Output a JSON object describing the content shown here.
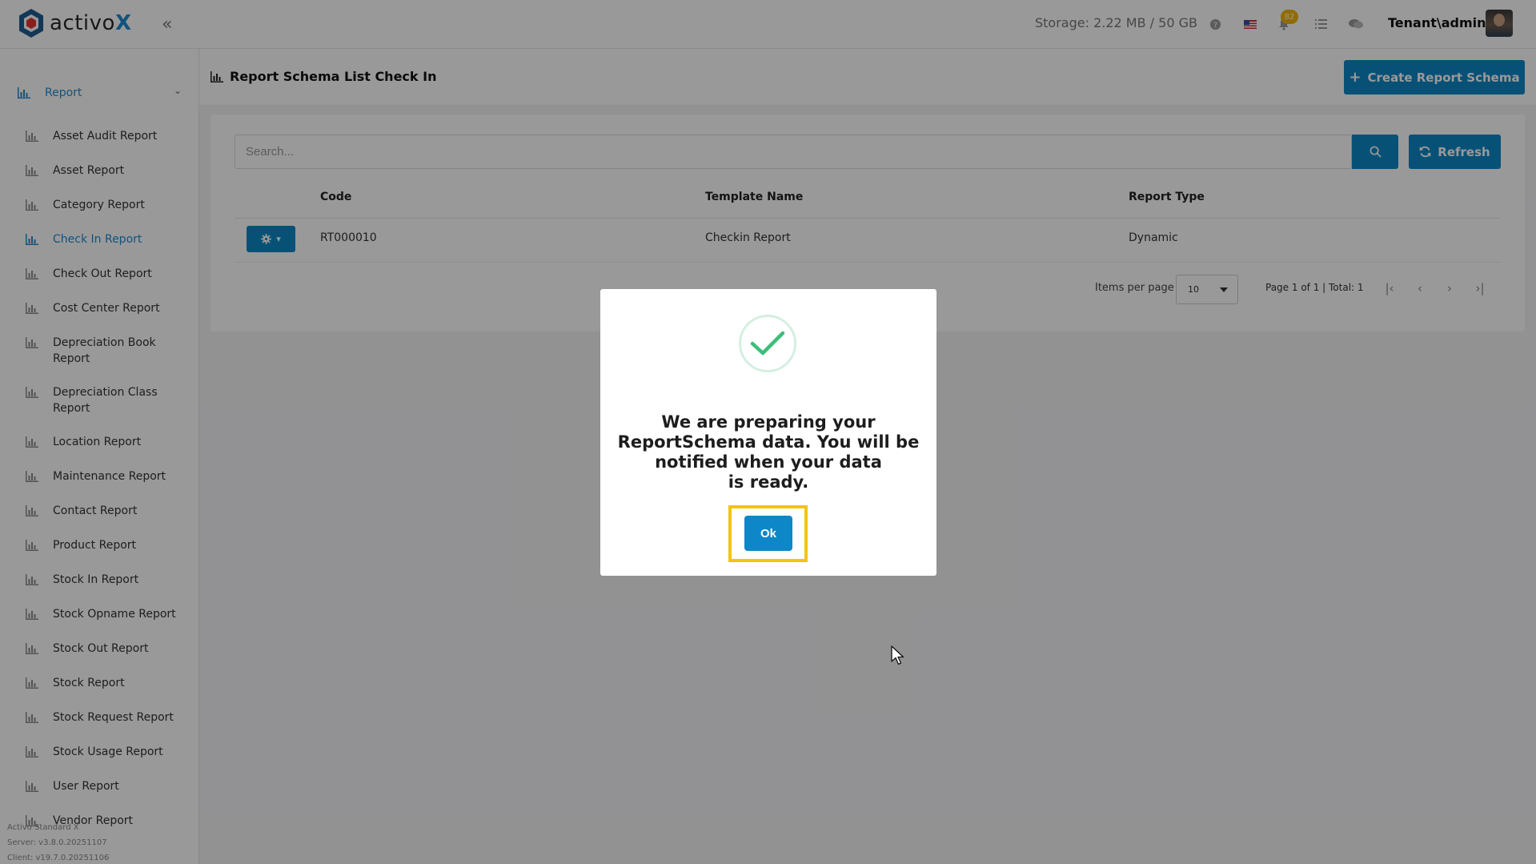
{
  "app": {
    "logo_text_main": "activo",
    "logo_text_accent": "X",
    "storage": "Storage: 2.22 MB / 50 GB",
    "notification_count": "82",
    "user": "Tenant\\admin",
    "icons": [
      "help-icon",
      "flag-us-icon",
      "bell-icon",
      "tasks-icon",
      "chat-icon"
    ]
  },
  "sidebar": {
    "section": "Report",
    "items": [
      {
        "label": "Asset Audit Report"
      },
      {
        "label": "Asset Report"
      },
      {
        "label": "Category Report"
      },
      {
        "label": "Check In Report"
      },
      {
        "label": "Check Out Report"
      },
      {
        "label": "Cost Center Report"
      },
      {
        "label": "Depreciation Book Report"
      },
      {
        "label": "Depreciation Class Report"
      },
      {
        "label": "Location Report"
      },
      {
        "label": "Maintenance Report"
      },
      {
        "label": "Contact Report"
      },
      {
        "label": "Product Report"
      },
      {
        "label": "Stock In Report"
      },
      {
        "label": "Stock Opname Report"
      },
      {
        "label": "Stock Out Report"
      },
      {
        "label": "Stock Report"
      },
      {
        "label": "Stock Request Report"
      },
      {
        "label": "Stock Usage Report"
      },
      {
        "label": "User Report"
      },
      {
        "label": "Vendor Report"
      }
    ],
    "active_item": "Check In Report",
    "footer": {
      "product": "Activo Standard X",
      "server": "Server: v3.8.0.20251107",
      "client": "Client: v19.7.0.20251106"
    }
  },
  "page": {
    "title": "Report Schema List Check In",
    "create_button": "Create Report Schema",
    "search_placeholder": "Search...",
    "refresh_button": "Refresh"
  },
  "table": {
    "columns": [
      "Code",
      "Template Name",
      "Report Type"
    ],
    "rows": [
      {
        "code": "RT000010",
        "template_name": "Checkin Report",
        "report_type": "Dynamic"
      }
    ]
  },
  "pagination": {
    "items_per_page_label": "Items per page",
    "items_per_page": "10",
    "page_info": "Page 1 of 1 | Total: 1"
  },
  "modal": {
    "message_lines": [
      "We are preparing your",
      "ReportSchema data. You will be",
      "notified when your data",
      "is ready."
    ],
    "ok_button": "Ok"
  },
  "colors": {
    "accent": "#0d87c7",
    "highlight": "#f2c511",
    "success": "#3ebd7a"
  }
}
